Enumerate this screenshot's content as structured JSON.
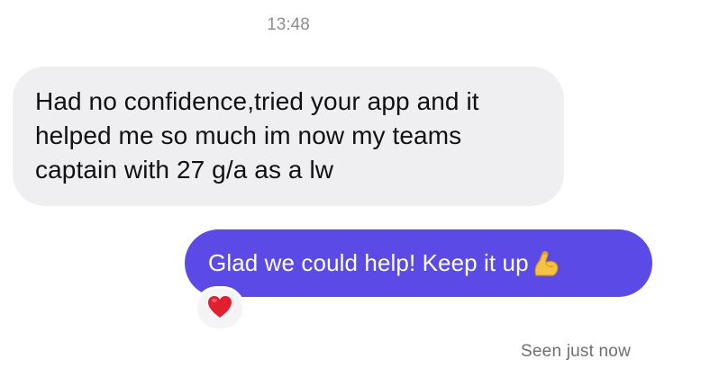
{
  "thread": {
    "timestamp": "13:48",
    "incoming": {
      "text": "Had no confidence,tried your app and it helped me so much im now my teams captain with 27 g/a as a lw"
    },
    "outgoing": {
      "text": "Glad we could help! Keep it up",
      "emoji_icon": "flexed-biceps-icon"
    },
    "reaction": {
      "icon": "red-heart-icon"
    },
    "status": "Seen just now"
  },
  "colors": {
    "incoming_bubble": "#efeff2",
    "outgoing_bubble": "#5b4ae6",
    "heart": "#e0202f"
  }
}
